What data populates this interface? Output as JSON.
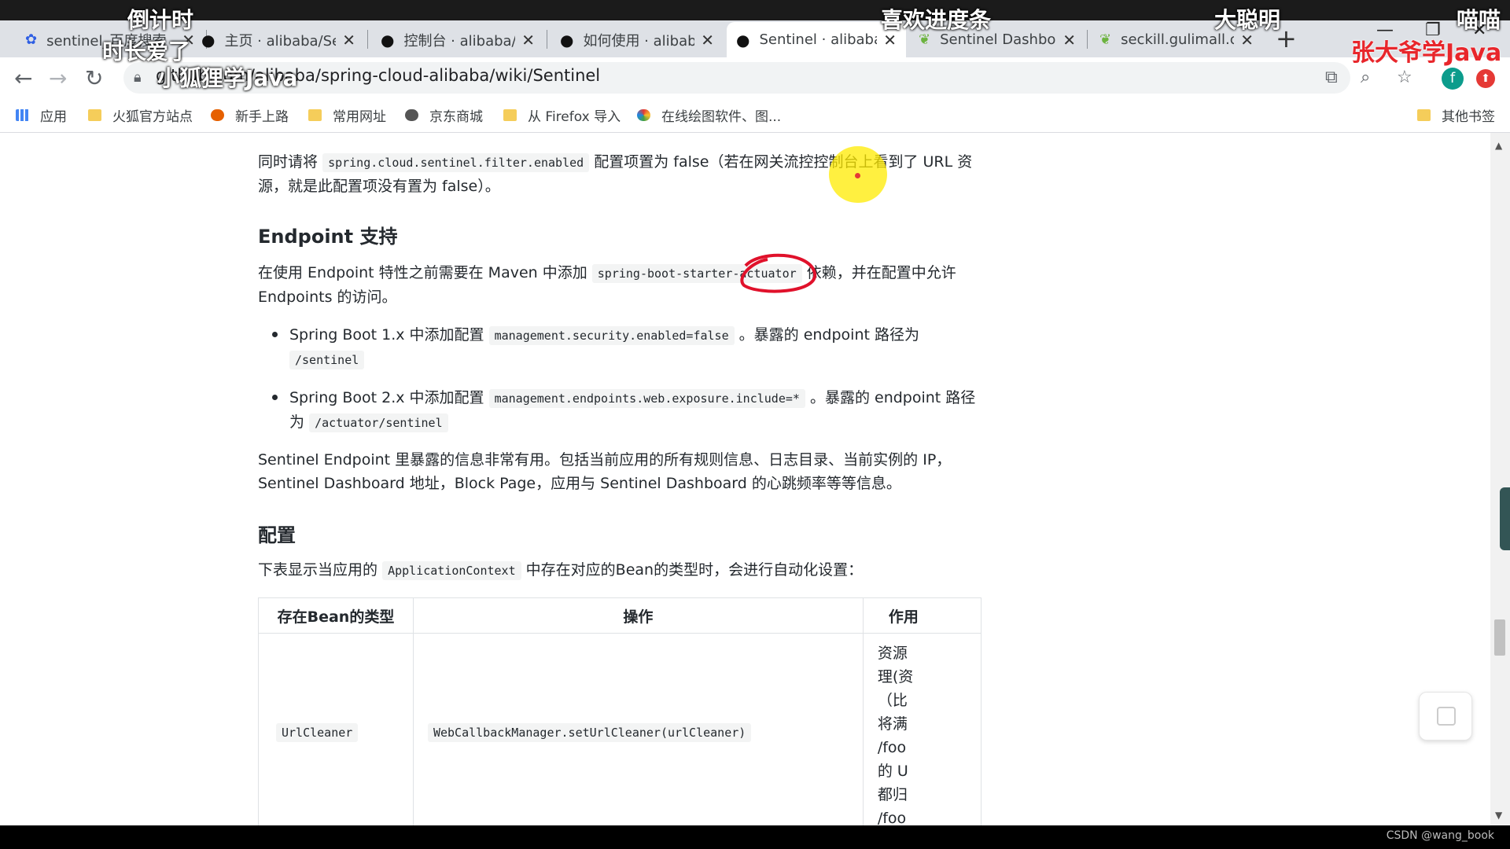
{
  "browser": {
    "tabs": [
      {
        "title": "sentinel_百度搜索",
        "icon": "baidu-paw-icon"
      },
      {
        "title": "主页 · alibaba/Sentinel",
        "icon": "github-icon"
      },
      {
        "title": "控制台 · alibaba/Sentinel",
        "icon": "github-icon"
      },
      {
        "title": "如何使用 · alibaba/Sentinel",
        "icon": "github-icon"
      },
      {
        "title": "Sentinel · alibaba",
        "icon": "github-icon",
        "active": true
      },
      {
        "title": "Sentinel Dashboard",
        "icon": "leaf-icon"
      },
      {
        "title": "seckill.gulimall.com",
        "icon": "leaf-icon"
      }
    ],
    "new_tab_label": "+",
    "address": "github.com/alibaba/spring-cloud-alibaba/wiki/Sentinel",
    "bookmarks": [
      {
        "label": "应用",
        "icon": "apps-grid-icon"
      },
      {
        "label": "火狐官方站点",
        "icon": "folder-icon"
      },
      {
        "label": "新手上路",
        "icon": "firefox-icon"
      },
      {
        "label": "常用网址",
        "icon": "folder-icon"
      },
      {
        "label": "京东商城",
        "icon": "globe-icon"
      },
      {
        "label": "从 Firefox 导入",
        "icon": "folder-icon"
      },
      {
        "label": "在线绘图软件、图...",
        "icon": "drawio-icon"
      }
    ],
    "other_bookmarks": "其他书签",
    "profile_letter": "f"
  },
  "overlays": {
    "danmaku_1": "倒计时",
    "danmaku_2": "时长爱了",
    "danmaku_3": "小狐狸学Java",
    "danmaku_4": "喜欢进度条",
    "danmaku_5": "大聪明",
    "danmaku_6": "喵喵",
    "channel_mark": "张大爷学Java"
  },
  "article": {
    "p1_a": "同时请将",
    "p1_code": "spring.cloud.sentinel.filter.enabled",
    "p1_b": "配置项置为 false（若在网关流控控制台上看到了 URL 资源，就是此配置项没有置为 false）。",
    "h_endpoint": "Endpoint 支持",
    "p2_a": "在使用 Endpoint 特性之前需要在 Maven 中添加",
    "p2_code": "spring-boot-starter-actuator",
    "p2_b": "依赖，并在配置中允许 Endpoints 的访问。",
    "li1_a": "Spring Boot 1.x 中添加配置",
    "li1_code": "management.security.enabled=false",
    "li1_b": "。暴露的 endpoint 路径为",
    "li1_path": "/sentinel",
    "li2_a": "Spring Boot 2.x 中添加配置",
    "li2_code": "management.endpoints.web.exposure.include=*",
    "li2_b": "。暴露的 endpoint 路径为",
    "li2_path": "/actuator/sentinel",
    "p3": "Sentinel Endpoint 里暴露的信息非常有用。包括当前应用的所有规则信息、日志目录、当前实例的 IP，Sentinel Dashboard 地址，Block Page，应用与 Sentinel Dashboard 的心跳频率等等信息。",
    "h_config": "配置",
    "p4_a": "下表显示当应用的",
    "p4_code": "ApplicationContext",
    "p4_b": "中存在对应的Bean的类型时，会进行自动化设置：",
    "table": {
      "headers": [
        "存在Bean的类型",
        "操作",
        "作用"
      ],
      "row1": {
        "type": "UrlCleaner",
        "op": "WebCallbackManager.setUrlCleaner(urlCleaner)",
        "effect_lines": [
          "资源",
          "理(资",
          "（比",
          "将满",
          "/foo",
          "的 U",
          "都归",
          "/foo"
        ]
      }
    }
  },
  "footer_watermark": "CSDN @wang_book"
}
